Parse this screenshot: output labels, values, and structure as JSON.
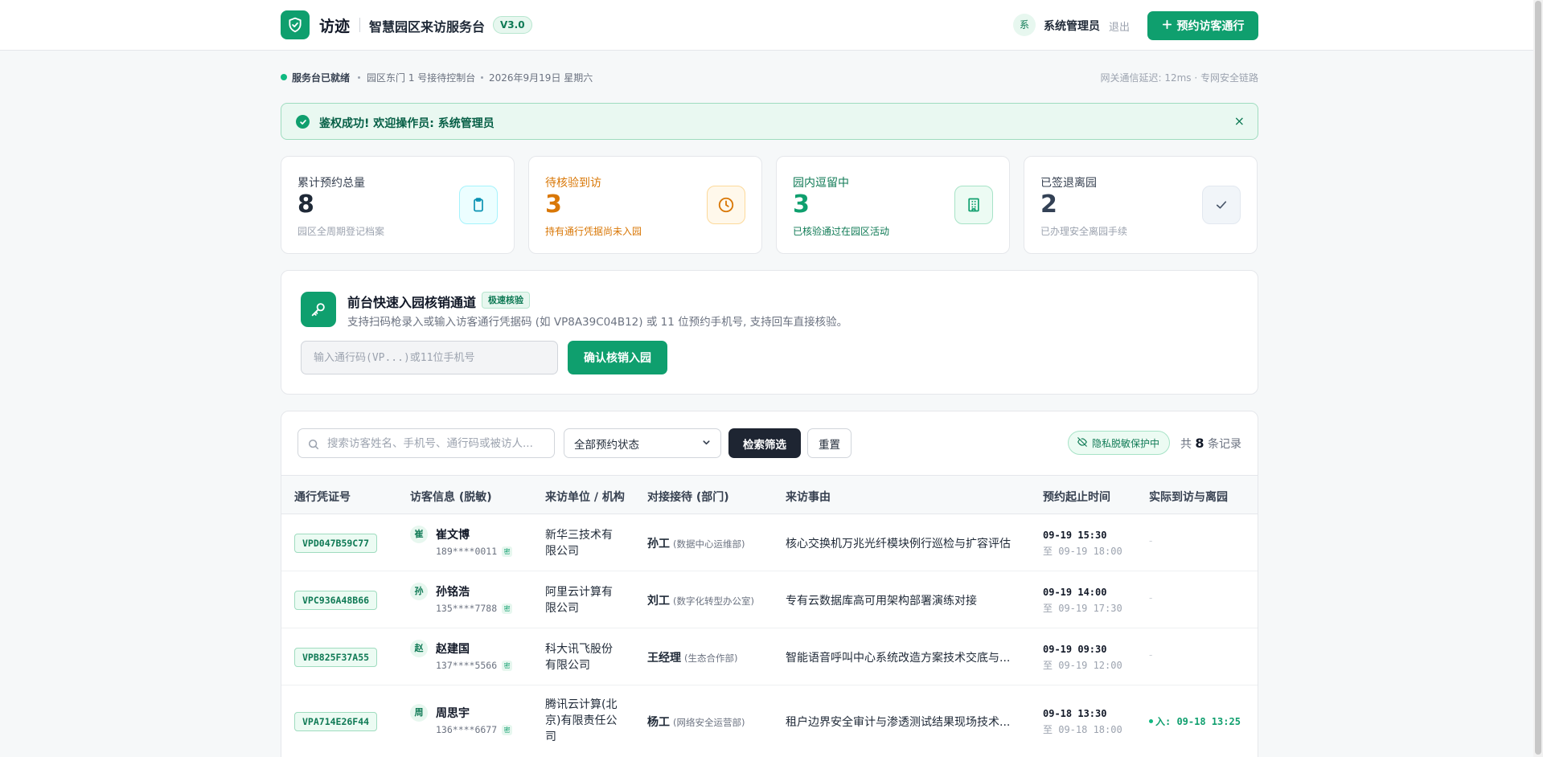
{
  "header": {
    "brand_name": "访迹",
    "brand_sub": "智慧园区来访服务台",
    "version": "V3.0",
    "user_avatar": "系",
    "user_name": "系统管理员",
    "logout": "退出",
    "book_button": "预约访客通行"
  },
  "status_bar": {
    "status": "服务台已就绪",
    "location": "园区东门 1 号接待控制台",
    "date": "2026年9月19日  星期六",
    "network": "网关通信延迟: 12ms  ·  专网安全链路"
  },
  "alert": {
    "message": "鉴权成功! 欢迎操作员: 系统管理员",
    "close": "×"
  },
  "stats": [
    {
      "label": "累计预约总量",
      "value": "8",
      "note": "园区全周期登记档案",
      "icon": "clipboard-icon",
      "color": "#1f2937",
      "accent": "#06b6d4"
    },
    {
      "label": "待核验到访",
      "value": "3",
      "note": "持有通行凭据尚未入园",
      "icon": "clock-icon",
      "color": "#d97706",
      "accent": "#d97706"
    },
    {
      "label": "园内逗留中",
      "value": "3",
      "note": "已核验通过在园区活动",
      "icon": "building-icon",
      "color": "#0f9f6e",
      "accent": "#0f9f6e"
    },
    {
      "label": "已签退离园",
      "value": "2",
      "note": "已办理安全离园手续",
      "icon": "check-icon",
      "color": "#334155",
      "accent": "#64748b"
    }
  ],
  "quick_verify": {
    "title": "前台快速入园核销通道",
    "tag": "极速核验",
    "description": "支持扫码枪录入或输入访客通行凭据码 (如 VP8A39C04B12) 或 11 位预约手机号, 支持回车直接核验。",
    "placeholder": "输入通行码(VP...)或11位手机号",
    "button": "确认核销入园"
  },
  "filters": {
    "search_placeholder": "搜索访客姓名、手机号、通行码或被访人...",
    "status_selected": "全部预约状态",
    "filter_button": "检索筛选",
    "reset_button": "重置",
    "privacy_badge": "隐私脱敏保护中",
    "count_prefix": "共",
    "count": "8",
    "count_suffix": "条记录"
  },
  "table": {
    "headers": [
      "通行凭证号",
      "访客信息 (脱敏)",
      "来访单位 / 机构",
      "对接接待 (部门)",
      "来访事由",
      "预约起止时间",
      "实际到访与离园"
    ],
    "rows": [
      {
        "pass": "VPD047B59C77",
        "avatar": "崔",
        "name": "崔文博",
        "phone": "189****0011",
        "org": "新华三技术有限公司",
        "host": "孙工",
        "dept": "(数据中心运维部)",
        "reason": "核心交换机万兆光纤模块例行巡检与扩容评估",
        "start": "09-19 15:30",
        "end": "至 09-19 18:00",
        "actual": "-"
      },
      {
        "pass": "VPC936A48B66",
        "avatar": "孙",
        "name": "孙铭浩",
        "phone": "135****7788",
        "org": "阿里云计算有限公司",
        "host": "刘工",
        "dept": "(数字化转型办公室)",
        "reason": "专有云数据库高可用架构部署演练对接",
        "start": "09-19 14:00",
        "end": "至 09-19 17:30",
        "actual": "-"
      },
      {
        "pass": "VPB825F37A55",
        "avatar": "赵",
        "name": "赵建国",
        "phone": "137****5566",
        "org": "科大讯飞股份有限公司",
        "host": "王经理",
        "dept": "(生态合作部)",
        "reason": "智能语音呼叫中心系统改造方案技术交底与...",
        "start": "09-19 09:30",
        "end": "至 09-19 12:00",
        "actual": "-"
      },
      {
        "pass": "VPA714E26F44",
        "avatar": "周",
        "name": "周思宇",
        "phone": "136****6677",
        "org": "腾讯云计算(北京)有限责任公司",
        "host": "杨工",
        "dept": "(网络安全运营部)",
        "reason": "租户边界安全审计与渗透测试结果现场技术...",
        "start": "09-18 13:30",
        "end": "至 09-18 18:00",
        "actual": "入: 09-18 13:25"
      }
    ],
    "mask_tag": "密"
  },
  "colors": {
    "accent": "#0f9f6e",
    "dark_button": "#1e2532",
    "pending": "#d97706"
  }
}
